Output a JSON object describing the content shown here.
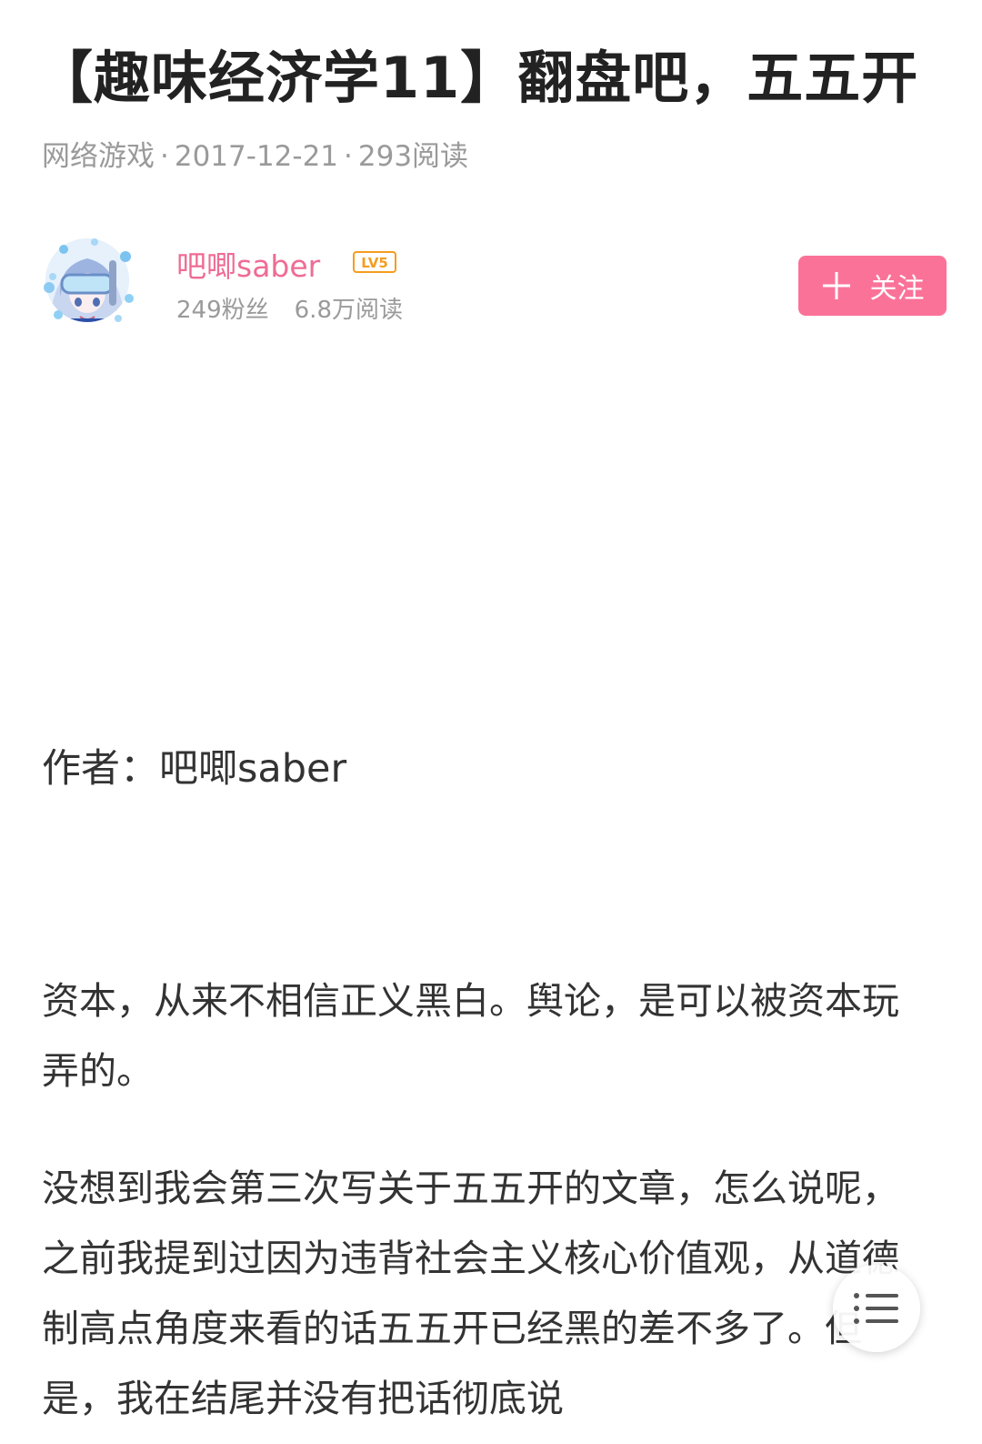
{
  "article": {
    "title": "【趣味经济学11】翻盘吧，五五开",
    "category": "网络游戏",
    "date": "2017-12-21",
    "reads": "293阅读"
  },
  "author": {
    "name": "吧唧saber",
    "level": "LV5",
    "fans": "249粉丝",
    "total_reads": "6.8万阅读",
    "avatar_icon": "avatar-image",
    "follow_label": "关注"
  },
  "body": {
    "byline": "作者：吧唧saber",
    "paragraphs": [
      "资本，从来不相信正义黑白。舆论，是可以被资本玩弄的。",
      "没想到我会第三次写关于五五开的文章，怎么说呢，之前我提到过因为违背社会主义核心价值观，从道德制高点角度来看的话五五开已经黑的差不多了。但是，我在结尾并没有把话彻底说"
    ]
  },
  "colors": {
    "accent": "#fb7299",
    "author_name": "#ee6c95",
    "level_badge": "#f59d1e"
  },
  "floating": {
    "toc_icon": "list-icon"
  }
}
